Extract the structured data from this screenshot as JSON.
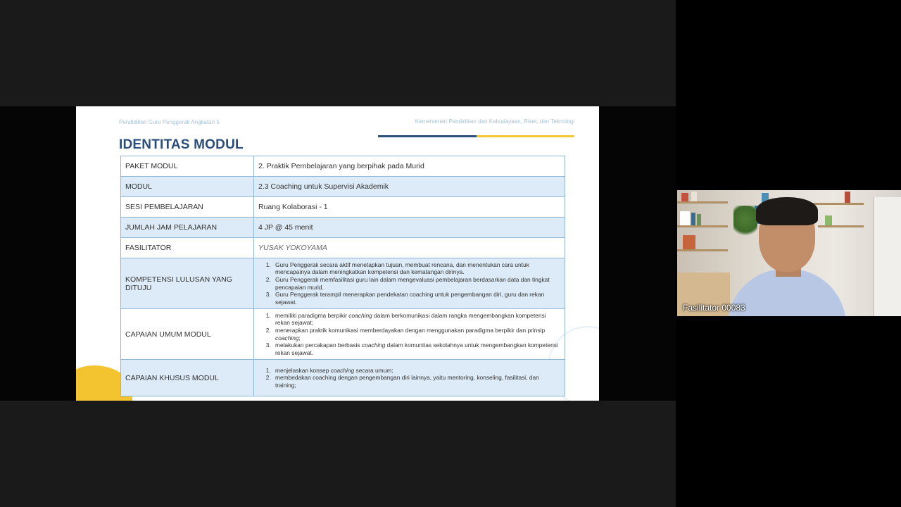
{
  "slide": {
    "header_left": "Pendidikan Guru Penggerak Angkatan 5",
    "header_right": "Kementerian Pendidikan dan Kebudayaan, Riset, dan Teknologi",
    "title": "IDENTITAS MODUL",
    "rows": [
      {
        "key": "PAKET MODUL",
        "value": "2. Praktik Pembelajaran yang berpihak pada Murid"
      },
      {
        "key": "MODUL",
        "value": "2.3 Coaching untuk Supervisi Akademik"
      },
      {
        "key": "SESI PEMBELAJARAN",
        "value": "Ruang Kolaborasi - 1"
      },
      {
        "key": "JUMLAH JAM PELAJARAN",
        "value": "4 JP @ 45 menit"
      },
      {
        "key": "FASILITATOR",
        "value": "YUSAK YOKOYAMA"
      },
      {
        "key": "KOMPETENSI LULUSAN YANG DITUJU",
        "items": [
          "Guru Penggerak secara aktif menetapkan tujuan, membuat rencana, dan menentukan cara untuk mencapainya dalam meningkatkan kompetensi dan kematangan dirinya.",
          "Guru Penggerak memfasilitasi guru lain dalam mengevaluasi pembelajaran berdasarkan data dan tingkat pencapaian murid.",
          "Guru Penggerak terampil menerapkan pendekatan coaching untuk pengembangan diri, guru dan rekan sejawat."
        ]
      },
      {
        "key": "CAPAIAN UMUM MODUL",
        "items": [
          {
            "before": "memiliki paradigma berpikir ",
            "em": "coaching",
            "after": " dalam berkomunikasi dalam rangka mengembangkan kompetensi rekan sejawat;"
          },
          {
            "before": "menerapkan praktik komunikasi memberdayakan dengan menggunakan paradigma berpikir dan prinsip ",
            "em": "coaching",
            "after": ";"
          },
          {
            "before": "melakukan percakapan berbasis ",
            "em": "coaching",
            "after": " dalam komunitas sekolahnya untuk mengembangkan kompetensi rekan sejawat."
          }
        ]
      },
      {
        "key": "CAPAIAN KHUSUS MODUL",
        "items": [
          {
            "before": "menjelaskan konsep ",
            "em": "coaching",
            "after": " secara umum;"
          },
          {
            "before": "membedakan coaching dengan pengembangan diri lainnya, yaitu mentoring, konseling, fasilitasi, dan training;",
            "em": "",
            "after": ""
          }
        ]
      }
    ]
  },
  "video": {
    "participant_name": "Fasilitator 00083"
  }
}
